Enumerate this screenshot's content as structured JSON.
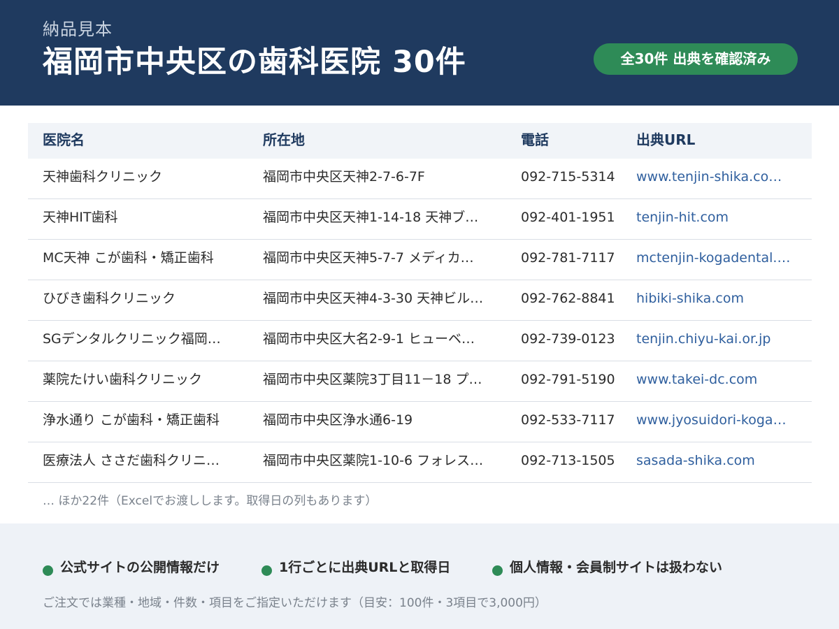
{
  "header": {
    "eyebrow": "納品見本",
    "title": "福岡市中央区の歯科医院 30件",
    "badge": "全30件 出典を確認済み"
  },
  "table": {
    "columns": [
      "医院名",
      "所在地",
      "電話",
      "出典URL"
    ],
    "rows": [
      {
        "name": "天神歯科クリニック",
        "address": "福岡市中央区天神2-7-6-7F",
        "phone": "092-715-5314",
        "url": "www.tenjin-shika.co…"
      },
      {
        "name": "天神HIT歯科",
        "address": "福岡市中央区天神1-14-18 天神ブ…",
        "phone": "092-401-1951",
        "url": "tenjin-hit.com"
      },
      {
        "name": "MC天神 こが歯科・矯正歯科",
        "address": "福岡市中央区天神5-7-7 メディカ…",
        "phone": "092-781-7117",
        "url": "mctenjin-kogadental.…"
      },
      {
        "name": "ひびき歯科クリニック",
        "address": "福岡市中央区天神4-3-30 天神ビル…",
        "phone": "092-762-8841",
        "url": "hibiki-shika.com"
      },
      {
        "name": "SGデンタルクリニック福岡…",
        "address": "福岡市中央区大名2-9-1 ヒューベ…",
        "phone": "092-739-0123",
        "url": "tenjin.chiyu-kai.or.jp"
      },
      {
        "name": "薬院たけい歯科クリニック",
        "address": "福岡市中央区薬院3丁目11－18 プ…",
        "phone": "092-791-5190",
        "url": "www.takei-dc.com"
      },
      {
        "name": "浄水通り こが歯科・矯正歯科",
        "address": "福岡市中央区浄水通6-19",
        "phone": "092-533-7117",
        "url": "www.jyosuidori-koga…"
      },
      {
        "name": "医療法人 ささだ歯科クリニ…",
        "address": "福岡市中央区薬院1-10-6 フォレス…",
        "phone": "092-713-1505",
        "url": "sasada-shika.com"
      }
    ],
    "more": "… ほか22件（Excelでお渡しします。取得日の列もあります）"
  },
  "footer": {
    "features": [
      "公式サイトの公開情報だけ",
      "1行ごとに出典URLと取得日",
      "個人情報・会員制サイトは扱わない"
    ],
    "note": "ご注文では業種・地域・件数・項目をご指定いただけます（目安：100件・3項目で3,000円）"
  },
  "colors": {
    "header_bg": "#1f3a5f",
    "accent_green": "#2e8b57",
    "link_blue": "#2f5f9e",
    "footer_bg": "#eef2f7"
  }
}
